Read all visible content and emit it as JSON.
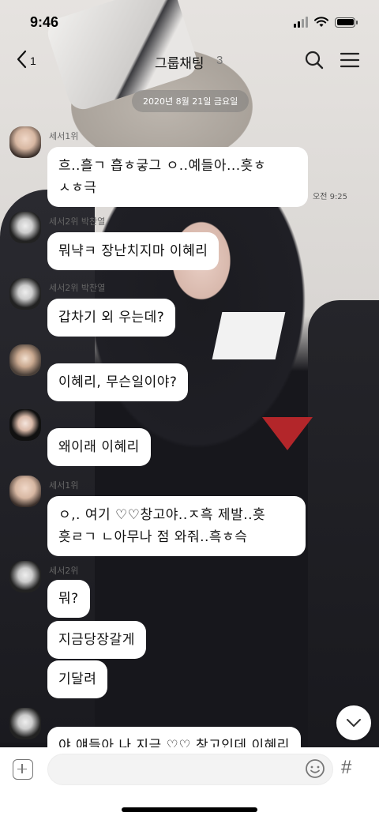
{
  "status": {
    "time": "9:46"
  },
  "header": {
    "back_count": "1",
    "title": "그룹채팅",
    "member_count": "3"
  },
  "date_divider": "2020년 8월 21일 금요일",
  "messages": [
    {
      "sender": "세서1위",
      "lines": [
        "흐..흘ㄱ 흡ㅎ긓그 ㅇ..예들아...흣ㅎ",
        "ㅅㅎ극"
      ],
      "time": "오전 9:25"
    },
    {
      "sender": "세서2위 박찬열",
      "lines": [
        "뭐냑ㅋ 장난치지마 이혜리"
      ]
    },
    {
      "sender": "세서2위 박찬열",
      "lines": [
        "갑차기 외 우는데?"
      ]
    },
    {
      "sender": "",
      "lines": [
        "이혜리, 무슨일이야?"
      ]
    },
    {
      "sender": "",
      "lines": [
        "왜이래 이혜리"
      ]
    },
    {
      "sender": "세서1위",
      "lines": [
        "ㅇ,. 여기 ♡♡창고야..ㅈ흑 제발..흣",
        "흣ㄹㄱ ㄴ아무나 점 와줘..흑ㅎ슥"
      ]
    },
    {
      "sender": "세서2위",
      "lines": [
        "뭐?"
      ]
    },
    {
      "sender": "",
      "lines": [
        "지금당장갈게"
      ]
    },
    {
      "sender": "",
      "lines": [
        "기달려"
      ]
    },
    {
      "sender": "",
      "lines": [
        "야 얘들아 나 지금 ♡♡ 창고인데 이혜리"
      ]
    }
  ],
  "input": {
    "value": "",
    "placeholder": ""
  },
  "icons": {
    "back": "chevron-left-icon",
    "search": "search-icon",
    "menu": "hamburger-menu-icon",
    "plus": "plus-box-icon",
    "emoji": "emoji-icon",
    "hash": "#",
    "scroll": "chevron-down-icon"
  }
}
